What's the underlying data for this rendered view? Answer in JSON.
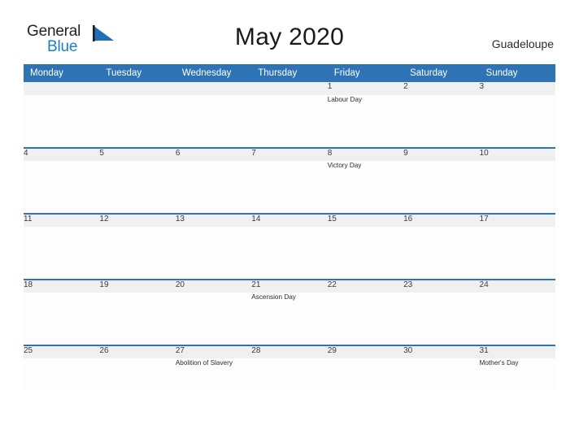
{
  "brand": {
    "name_line1": "General",
    "name_line2": "Blue",
    "flag_icon": "blue-triangle-flag",
    "accent_color": "#1b7fc4"
  },
  "header": {
    "title": "May 2020",
    "region": "Guadeloupe"
  },
  "theme": {
    "header_blue": "#2e73b4",
    "date_row_background": "#f0f0f0",
    "body_background": "#fdfdfd",
    "text_color": "#2b2b2b"
  },
  "calendar": {
    "month": "May",
    "year": "2020",
    "weekday_headers": [
      "Monday",
      "Tuesday",
      "Wednesday",
      "Thursday",
      "Friday",
      "Saturday",
      "Sunday"
    ],
    "weeks": [
      {
        "dates": [
          "",
          "",
          "",
          "",
          "1",
          "2",
          "3"
        ],
        "events": [
          "",
          "",
          "",
          "",
          "Labour Day",
          "",
          ""
        ]
      },
      {
        "dates": [
          "4",
          "5",
          "6",
          "7",
          "8",
          "9",
          "10"
        ],
        "events": [
          "",
          "",
          "",
          "",
          "Victory Day",
          "",
          ""
        ]
      },
      {
        "dates": [
          "11",
          "12",
          "13",
          "14",
          "15",
          "16",
          "17"
        ],
        "events": [
          "",
          "",
          "",
          "",
          "",
          "",
          ""
        ]
      },
      {
        "dates": [
          "18",
          "19",
          "20",
          "21",
          "22",
          "23",
          "24"
        ],
        "events": [
          "",
          "",
          "",
          "Ascension Day",
          "",
          "",
          ""
        ]
      },
      {
        "dates": [
          "25",
          "26",
          "27",
          "28",
          "29",
          "30",
          "31"
        ],
        "events": [
          "",
          "",
          "Abolition of Slavery",
          "",
          "",
          "",
          "Mother's Day"
        ]
      }
    ]
  }
}
